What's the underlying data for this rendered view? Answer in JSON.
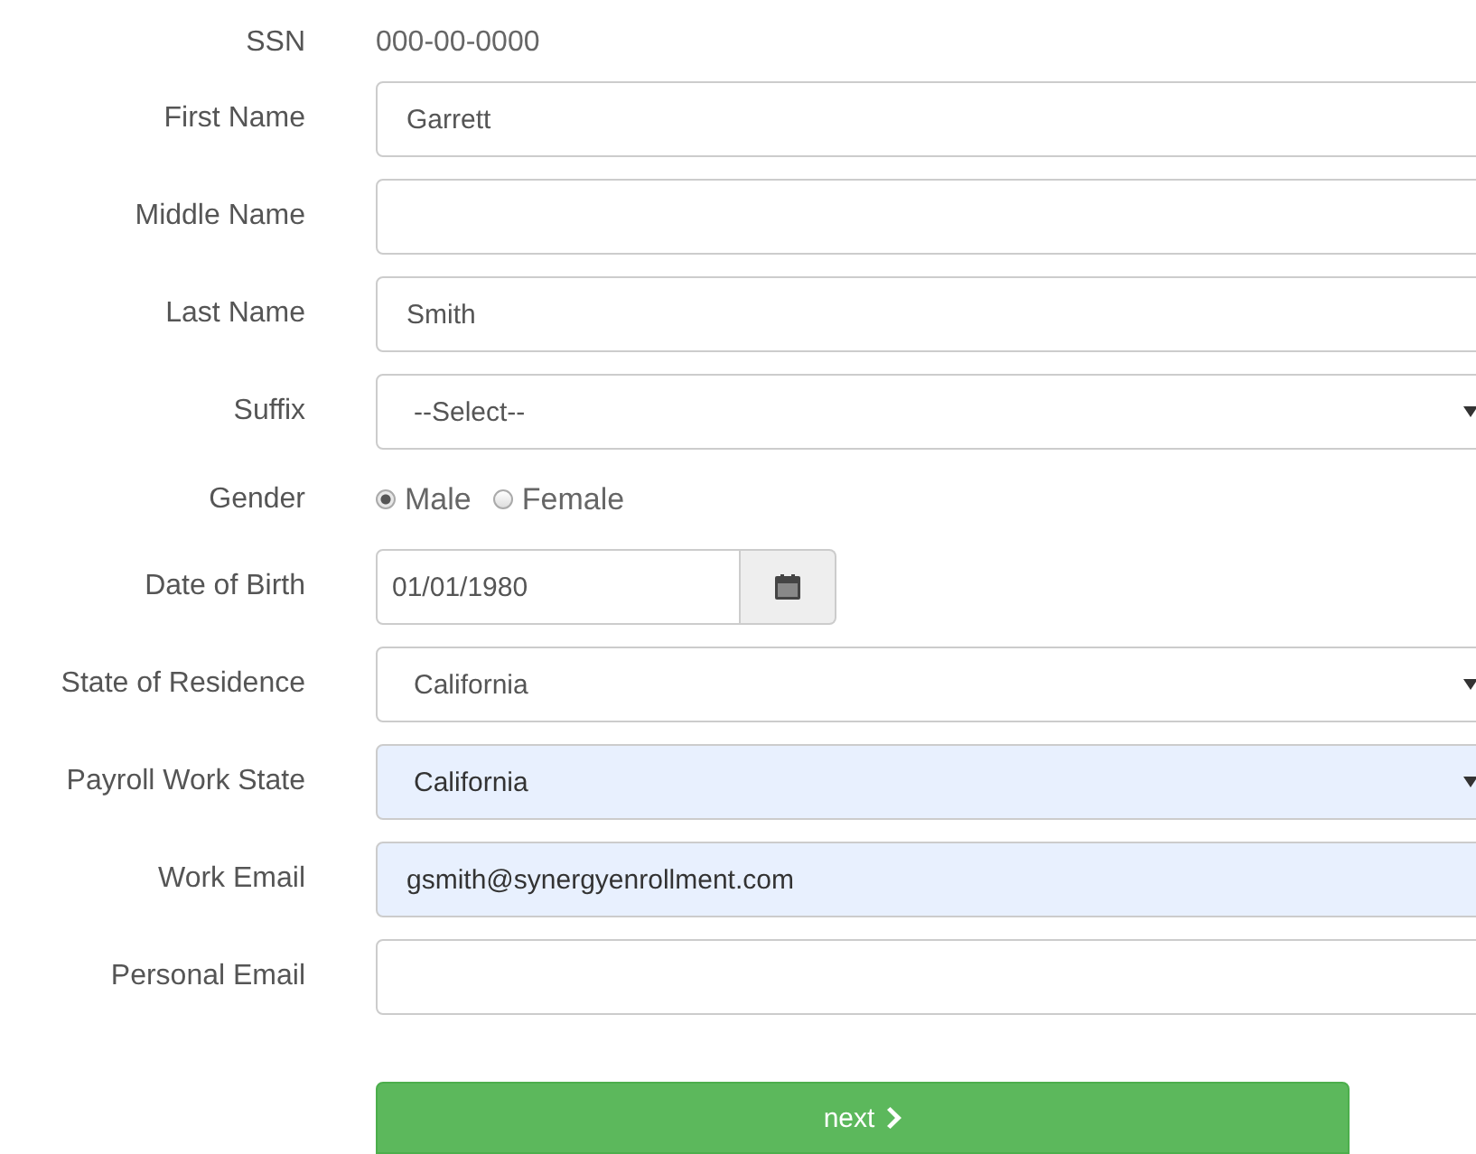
{
  "fields": [
    {
      "kind": "static",
      "label": "SSN",
      "value": "000-00-0000"
    },
    {
      "kind": "text",
      "label": "First Name",
      "value": "Garrett",
      "autofilled": false
    },
    {
      "kind": "text",
      "label": "Middle Name",
      "autofilled": false
    },
    {
      "kind": "text",
      "label": "Last Name",
      "value": "Smith",
      "autofilled": false
    },
    {
      "kind": "select",
      "label": "Suffix",
      "value": "--Select--",
      "autofilled": false
    },
    {
      "kind": "radio",
      "label": "Gender",
      "options": [
        {
          "label": "Male",
          "selected": true
        },
        {
          "label": "Female",
          "selected": false
        }
      ]
    },
    {
      "kind": "date",
      "label": "Date of Birth",
      "value": "01/01/1980"
    },
    {
      "kind": "select",
      "label": "State of Residence",
      "value": "California",
      "autofilled": false
    },
    {
      "kind": "select",
      "label": "Payroll Work State",
      "value": "California",
      "autofilled": true
    },
    {
      "kind": "text",
      "label": "Work Email",
      "value": "gsmith@synergyenrollment.com",
      "autofilled": true
    },
    {
      "kind": "text",
      "label": "Personal Email",
      "autofilled": false
    }
  ],
  "next_button": {
    "label": "next"
  }
}
